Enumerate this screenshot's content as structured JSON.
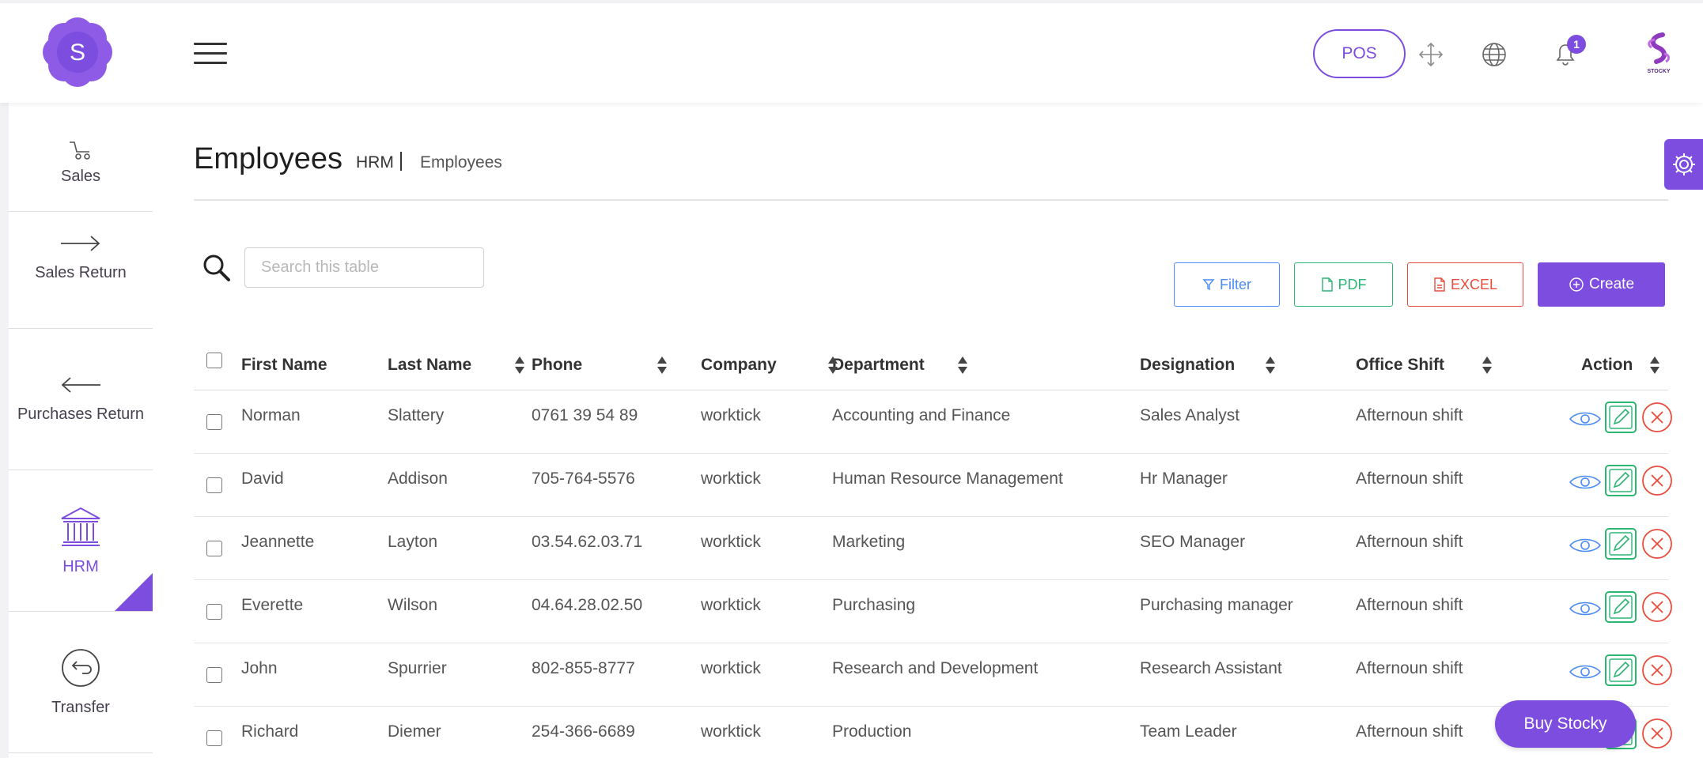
{
  "colors": {
    "accent": "#7c4dde",
    "filter": "#4a8bf5",
    "pdf": "#2bb673",
    "excel": "#e74c3c"
  },
  "header": {
    "logo_letter": "S",
    "pos_label": "POS",
    "notification_count": "1",
    "brand_caption": "STOCKY",
    "icons": [
      "menu-icon",
      "fullscreen-icon",
      "globe-icon",
      "bell-icon"
    ]
  },
  "sidebar": {
    "items": [
      {
        "label": "Sales",
        "icon": "cart-icon"
      },
      {
        "label": "Sales Return",
        "icon": "arrow-right-icon"
      },
      {
        "label": "Purchases Return",
        "icon": "arrow-left-icon"
      },
      {
        "label": "HRM",
        "icon": "bank-icon",
        "active": true
      },
      {
        "label": "Transfer",
        "icon": "transfer-icon"
      }
    ]
  },
  "page": {
    "title": "Employees",
    "breadcrumb": [
      "HRM",
      "Employees"
    ]
  },
  "toolbar": {
    "search_placeholder": "Search this table",
    "filter_label": "Filter",
    "pdf_label": "PDF",
    "excel_label": "EXCEL",
    "create_label": "Create"
  },
  "table": {
    "columns": [
      "First Name",
      "Last Name",
      "Phone",
      "Company",
      "Department",
      "Designation",
      "Office Shift",
      "Action"
    ],
    "rows": [
      [
        "Norman",
        "Slattery",
        "0761 39 54 89",
        "worktick",
        "Accounting and Finance",
        "Sales Analyst",
        "Afternoun shift"
      ],
      [
        "David",
        "Addison",
        "705-764-5576",
        "worktick",
        "Human Resource Management",
        "Hr Manager",
        "Afternoun shift"
      ],
      [
        "Jeannette",
        "Layton",
        "03.54.62.03.71",
        "worktick",
        "Marketing",
        "SEO Manager",
        "Afternoun shift"
      ],
      [
        "Everette",
        "Wilson",
        "04.64.28.02.50",
        "worktick",
        "Purchasing",
        "Purchasing manager",
        "Afternoun shift"
      ],
      [
        "John",
        "Spurrier",
        "802-855-8777",
        "worktick",
        "Research and Development",
        "Research Assistant",
        "Afternoun shift"
      ],
      [
        "Richard",
        "Diemer",
        "254-366-6689",
        "worktick",
        "Production",
        "Team Leader",
        "Afternoun shift"
      ]
    ]
  },
  "buy_button": "Buy Stocky"
}
